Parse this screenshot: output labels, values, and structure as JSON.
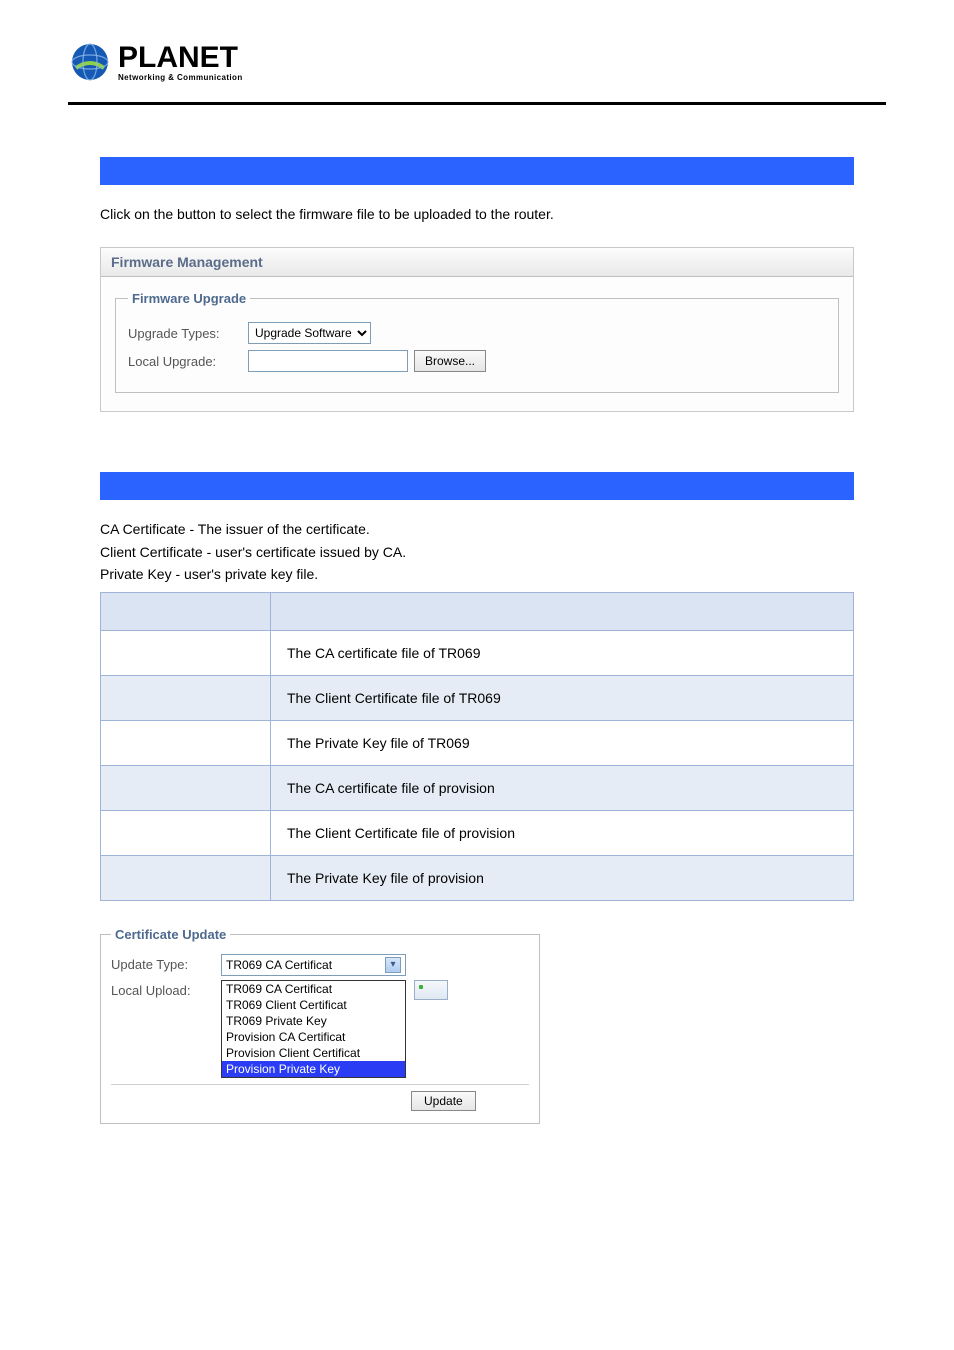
{
  "logo": {
    "brand": "PLANET",
    "tagline": "Networking & Communication"
  },
  "section_firmware": {
    "intro_pre": "Click on the ",
    "intro_post": " button to select the firmware file to be uploaded to the router.",
    "panel_title": "Firmware Management",
    "fieldset_title": "Firmware Upgrade",
    "upgrade_types_label": "Upgrade Types:",
    "upgrade_types_value": "Upgrade Software",
    "local_upgrade_label": "Local Upgrade:",
    "browse_label": "Browse..."
  },
  "section_cert": {
    "line1": "CA Certificate - The issuer of the certificate.",
    "line2": "Client Certificate - user's certificate issued by CA.",
    "line3": "Private Key - user's private key file.",
    "table": {
      "rows": [
        {
          "desc": "The CA certificate file of TR069"
        },
        {
          "desc": "The Client Certificate file of TR069"
        },
        {
          "desc": "The Private Key file of TR069"
        },
        {
          "desc": "The CA certificate file of provision"
        },
        {
          "desc": "The Client Certificate file of provision"
        },
        {
          "desc": "The Private Key file of provision"
        }
      ]
    },
    "update_box": {
      "legend": "Certificate Update",
      "update_type_label": "Update Type:",
      "update_type_value": "TR069 CA Certificat",
      "local_upload_label": "Local Upload:",
      "options": [
        "TR069 CA Certificat",
        "TR069 Client Certificat",
        "TR069 Private Key",
        "Provision CA Certificat",
        "Provision Client Certificat",
        "Provision Private Key"
      ],
      "highlight_index": 5,
      "update_btn": "Update"
    }
  }
}
